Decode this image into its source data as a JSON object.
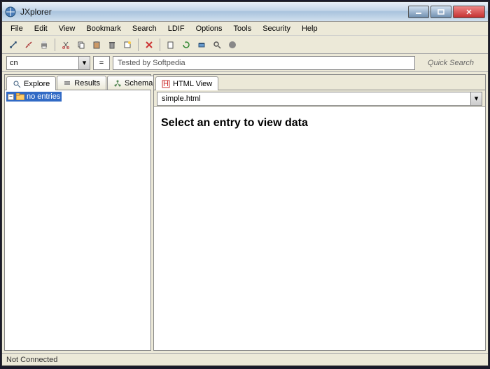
{
  "title": "JXplorer",
  "menu": [
    "File",
    "Edit",
    "View",
    "Bookmark",
    "Search",
    "LDIF",
    "Options",
    "Tools",
    "Security",
    "Help"
  ],
  "search": {
    "attr": "cn",
    "op": "=",
    "value": "Tested by Softpedia",
    "quick_label": "Quick Search"
  },
  "left_tabs": [
    {
      "label": "Explore",
      "active": true
    },
    {
      "label": "Results",
      "active": false
    },
    {
      "label": "Schema",
      "active": false
    }
  ],
  "tree_root": "no entries",
  "right_tabs": [
    {
      "label": "HTML View",
      "active": true
    }
  ],
  "template_file": "simple.html",
  "view_message": "Select an entry to view data",
  "status": "Not Connected"
}
